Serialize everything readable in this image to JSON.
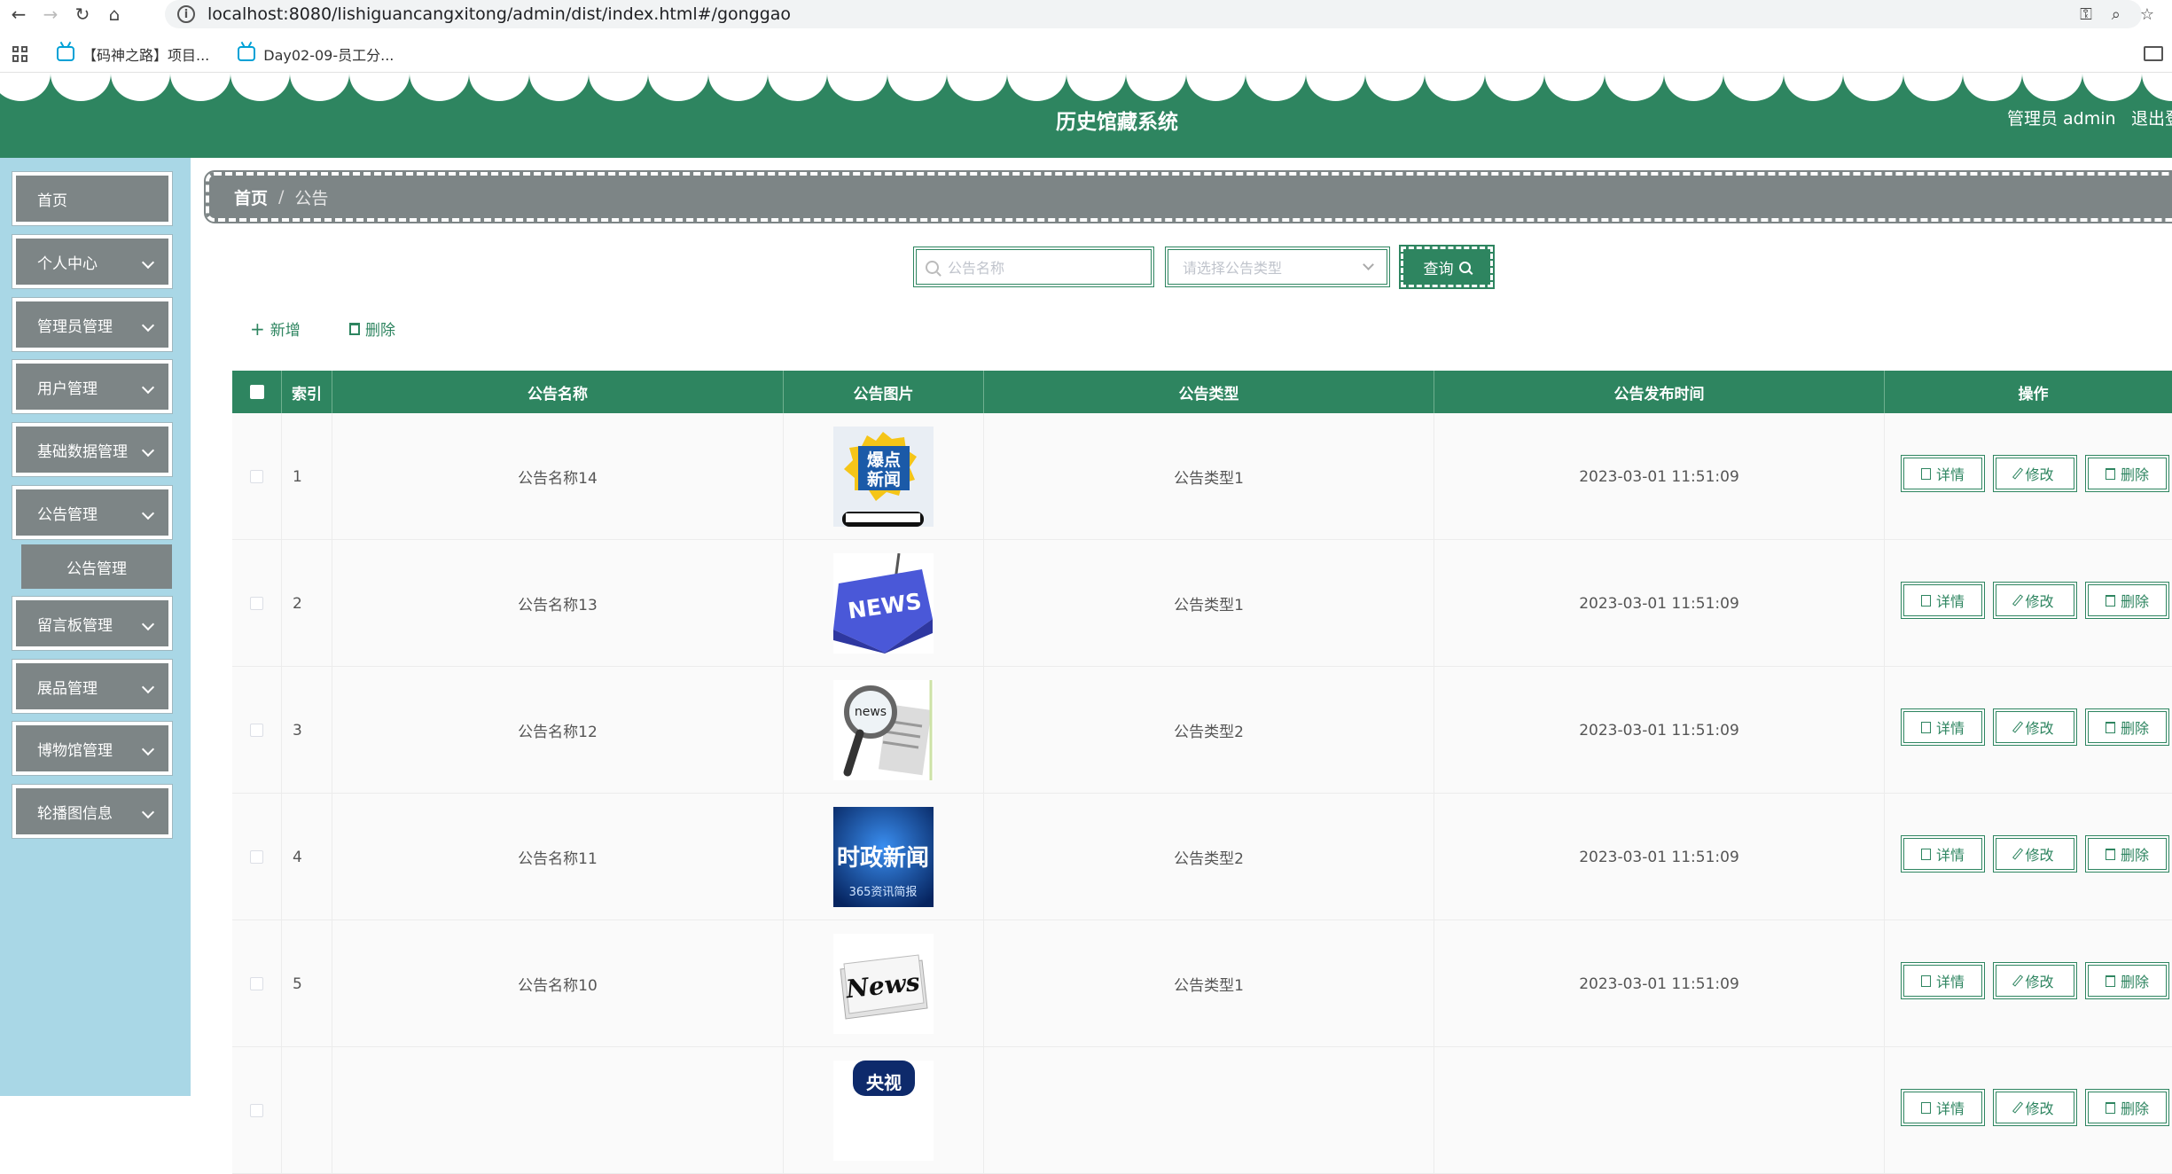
{
  "browser": {
    "url": "localhost:8080/lishiguancangxitong/admin/dist/index.html#/gonggao",
    "bookmarks": [
      "【码神之路】项目...",
      "Day02-09-员工分..."
    ]
  },
  "header": {
    "title": "历史馆藏系统",
    "admin": "管理员 admin",
    "logout": "退出登录"
  },
  "sidebar": {
    "items": [
      {
        "label": "首页",
        "expandable": false
      },
      {
        "label": "个人中心",
        "expandable": true
      },
      {
        "label": "管理员管理",
        "expandable": true
      },
      {
        "label": "用户管理",
        "expandable": true
      },
      {
        "label": "基础数据管理",
        "expandable": true
      },
      {
        "label": "公告管理",
        "expandable": true
      },
      {
        "label": "留言板管理",
        "expandable": true
      },
      {
        "label": "展品管理",
        "expandable": true
      },
      {
        "label": "博物馆管理",
        "expandable": true
      },
      {
        "label": "轮播图信息",
        "expandable": true
      }
    ],
    "submenu": {
      "label": "公告管理"
    }
  },
  "breadcrumb": {
    "home": "首页",
    "separator": "/",
    "current": "公告"
  },
  "search": {
    "name_placeholder": "公告名称",
    "type_placeholder": "请选择公告类型",
    "query_label": "查询"
  },
  "toolbar": {
    "add_label": "新增",
    "delete_label": "删除"
  },
  "table": {
    "columns": [
      "索引",
      "公告名称",
      "公告图片",
      "公告类型",
      "公告发布时间",
      "操作"
    ],
    "actions": {
      "detail": "详情",
      "edit": "修改",
      "delete": "删除"
    },
    "rows": [
      {
        "index": "1",
        "name": "公告名称14",
        "image_text": "爆点\n新闻",
        "image": "news-blast-icon",
        "type": "公告类型1",
        "time": "2023-03-01 11:51:09"
      },
      {
        "index": "2",
        "name": "公告名称13",
        "image_text": "NEWS",
        "image": "news-keyboard-icon",
        "type": "公告类型1",
        "time": "2023-03-01 11:51:09"
      },
      {
        "index": "3",
        "name": "公告名称12",
        "image_text": "news",
        "image": "magnifier-news-icon",
        "type": "公告类型2",
        "time": "2023-03-01 11:51:09"
      },
      {
        "index": "4",
        "name": "公告名称11",
        "image_text": "时政新闻",
        "image_subtext": "365资讯简报",
        "image": "politics-news-icon",
        "type": "公告类型2",
        "time": "2023-03-01 11:51:09"
      },
      {
        "index": "5",
        "name": "公告名称10",
        "image_text": "News",
        "image": "newspaper-icon",
        "type": "公告类型1",
        "time": "2023-03-01 11:51:09"
      },
      {
        "index": "",
        "name": "",
        "image_text": "央视",
        "image": "cctv-icon",
        "type": "",
        "time": ""
      }
    ]
  },
  "colors": {
    "primary": "#2e8560",
    "sidebar_bg": "#a9d7e6",
    "menu_bg": "#7d8586"
  }
}
